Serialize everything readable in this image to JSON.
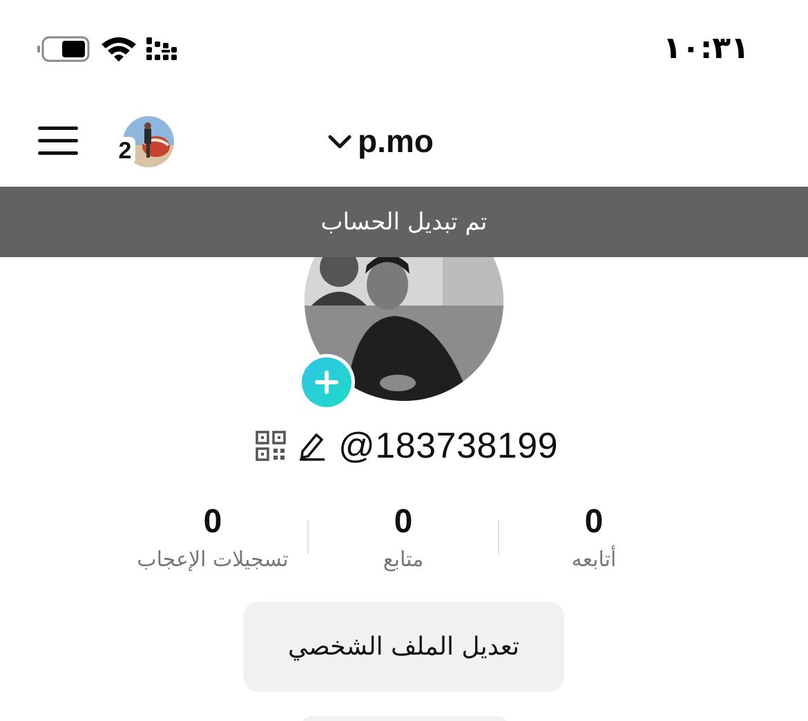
{
  "status_bar": {
    "time": "١٠:٣١",
    "icons": [
      "battery-icon",
      "wifi-icon",
      "signal-icon"
    ]
  },
  "header": {
    "menu_icon": "hamburger-menu-icon",
    "account_badge": "2",
    "username": "p.mo",
    "switch_icon": "chevron-down-icon"
  },
  "toast": {
    "message": "تم تبديل الحساب"
  },
  "profile": {
    "handle": "@183738199",
    "add_icon": "plus-icon",
    "edit_icon": "pencil-icon",
    "qr_icon": "qr-code-icon"
  },
  "stats": {
    "following": {
      "value": "0",
      "label": "أتابعه"
    },
    "followers": {
      "value": "0",
      "label": "متابع"
    },
    "likes": {
      "value": "0",
      "label": "تسجيلات الإعجاب"
    }
  },
  "actions": {
    "edit_profile": "تعديل الملف الشخصي"
  },
  "colors": {
    "toast_bg": "#626262",
    "accent_gradient_start": "#2ec6e6",
    "accent_gradient_end": "#21d9c8",
    "button_bg": "#f1f1f1",
    "label_gray": "#777777"
  }
}
